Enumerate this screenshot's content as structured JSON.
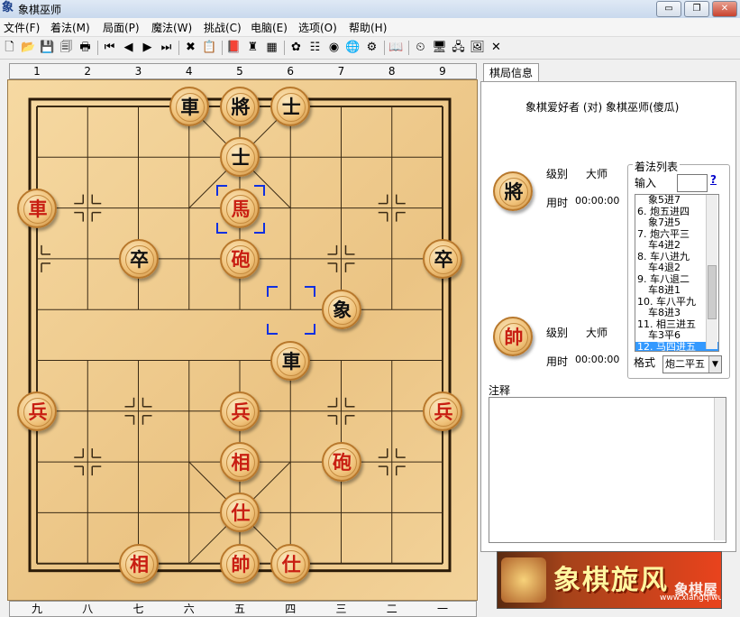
{
  "window": {
    "icon": "象",
    "title": "象棋巫师",
    "buttons": [
      "▭",
      "❐",
      "✕"
    ]
  },
  "menu": [
    "文件(F)",
    "着法(M)",
    "局面(P)",
    "魔法(W)",
    "挑战(C)",
    "电脑(E)",
    "选项(O)",
    "帮助(H)"
  ],
  "toolbar_icons": [
    "new-file-icon",
    "open-folder-icon",
    "save-icon",
    "save-as-icon",
    "print-icon",
    "first-move-icon",
    "prev-move-icon",
    "next-move-icon",
    "last-move-icon",
    "delete-icon",
    "paste-icon",
    "book-icon",
    "engine-icon",
    "calculator-icon",
    "color-icon",
    "tree-icon",
    "weibo-icon",
    "web-icon",
    "settings-icon",
    "library-icon",
    "clock-icon",
    "computer-icon",
    "network-icon",
    "image-icon",
    "close-icon"
  ],
  "toolbar_glyphs": [
    "🗋",
    "📂",
    "💾",
    "🗐",
    "🖶",
    "⏮",
    "◀",
    "▶",
    "⏭",
    "✖",
    "📋",
    "📕",
    "♜",
    "▦",
    "✿",
    "☷",
    "◉",
    "🌐",
    "⚙",
    "📖",
    "⏲",
    "🖥",
    "🖧",
    "🖼",
    "✕"
  ],
  "coords_top": [
    "1",
    "2",
    "3",
    "4",
    "5",
    "6",
    "7",
    "8",
    "9"
  ],
  "coords_bottom": [
    "九",
    "八",
    "七",
    "六",
    "五",
    "四",
    "三",
    "二",
    "一"
  ],
  "pieces": [
    {
      "char": "車",
      "side": "black",
      "col": 3,
      "row": 0
    },
    {
      "char": "將",
      "side": "black",
      "col": 4,
      "row": 0
    },
    {
      "char": "士",
      "side": "black",
      "col": 5,
      "row": 0
    },
    {
      "char": "士",
      "side": "black",
      "col": 4,
      "row": 1
    },
    {
      "char": "車",
      "side": "red",
      "col": 0,
      "row": 2
    },
    {
      "char": "馬",
      "side": "red",
      "col": 4,
      "row": 2
    },
    {
      "char": "卒",
      "side": "black",
      "col": 2,
      "row": 3
    },
    {
      "char": "砲",
      "side": "red",
      "col": 4,
      "row": 3
    },
    {
      "char": "卒",
      "side": "black",
      "col": 8,
      "row": 3
    },
    {
      "char": "象",
      "side": "black",
      "col": 6,
      "row": 4
    },
    {
      "char": "車",
      "side": "black",
      "col": 5,
      "row": 5
    },
    {
      "char": "兵",
      "side": "red",
      "col": 0,
      "row": 6
    },
    {
      "char": "兵",
      "side": "red",
      "col": 4,
      "row": 6
    },
    {
      "char": "兵",
      "side": "red",
      "col": 8,
      "row": 6
    },
    {
      "char": "相",
      "side": "red",
      "col": 4,
      "row": 7
    },
    {
      "char": "砲",
      "side": "red",
      "col": 6,
      "row": 7
    },
    {
      "char": "仕",
      "side": "red",
      "col": 4,
      "row": 8
    },
    {
      "char": "相",
      "side": "red",
      "col": 2,
      "row": 9
    },
    {
      "char": "帥",
      "side": "red",
      "col": 4,
      "row": 9
    },
    {
      "char": "仕",
      "side": "red",
      "col": 5,
      "row": 9
    }
  ],
  "selections": [
    {
      "col": 4,
      "row": 2
    },
    {
      "col": 5,
      "row": 4
    }
  ],
  "panel": {
    "tab": "棋局信息",
    "match": "象棋爱好者 (对) 象棋巫师(傻瓜)",
    "top_player": {
      "piece": "將",
      "level_label": "级别",
      "level": "大师",
      "time_label": "用时",
      "time": "00:00:00"
    },
    "bottom_player": {
      "piece": "帥",
      "level_label": "级别",
      "level": "大师",
      "time_label": "用时",
      "time": "00:00:00"
    },
    "moves_title": "着法列表",
    "input_label": "输入",
    "help": "?",
    "moves": [
      "象5进7",
      "6. 炮五进四",
      "象7进5",
      "7. 炮六平三",
      "车4进2",
      "8. 车八进九",
      "车4退2",
      "9. 车八退二",
      "车8进1",
      "10. 车八平九",
      "车8进3",
      "11. 相三进五",
      "车3平6",
      "12. 马四进五"
    ],
    "selected_move_index": 13,
    "format_label": "格式",
    "format_value": "炮二平五",
    "notes_label": "注释",
    "banner_title": "象棋旋风",
    "banner_url": "www.xiangqiwu.com",
    "banner_watermark": "象棋屋"
  }
}
